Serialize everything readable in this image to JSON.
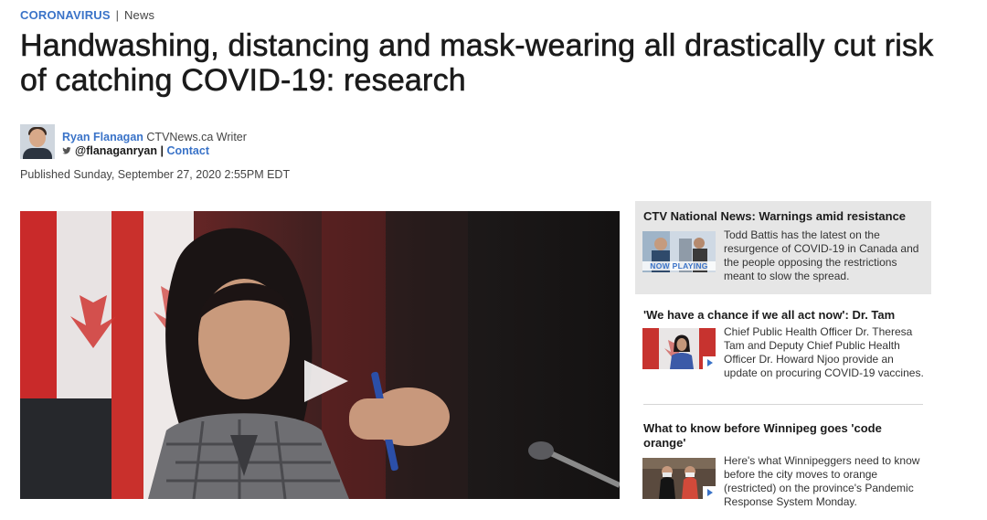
{
  "section": {
    "category": "CORONAVIRUS",
    "separator": "|",
    "subcategory": "News"
  },
  "headline": "Handwashing, distancing and mask-wearing all drastically cut risk of catching COVID-19: research",
  "author": {
    "name": "Ryan Flanagan",
    "role": "CTVNews.ca Writer",
    "twitter": "@flanaganryan",
    "separator": "|",
    "contact": "Contact"
  },
  "published": "Published Sunday, September 27, 2020 2:55PM EDT",
  "icons": {
    "twitter": "twitter-bird-icon",
    "play": "play-icon"
  },
  "colors": {
    "accent": "#3a73c8",
    "now_playing_bg": "#e6e6e6"
  },
  "sidebar": {
    "items": [
      {
        "title": "CTV National News: Warnings amid resistance",
        "description": "Todd Battis has the latest on the resurgence of COVID-19 in Canada and the people opposing the restrictions meant to slow the spread.",
        "badge": "NOW PLAYING"
      },
      {
        "title": "'We have a chance if we all act now': Dr. Tam",
        "description": "Chief Public Health Officer Dr. Theresa Tam and Deputy Chief Public Health Officer Dr. Howard Njoo provide an update on procuring COVID-19 vaccines."
      },
      {
        "title": "What to know before Winnipeg goes 'code orange'",
        "description": "Here's what Winnipeggers need to know before the city moves to orange (restricted) on the province's Pandemic Response System Monday."
      }
    ]
  }
}
